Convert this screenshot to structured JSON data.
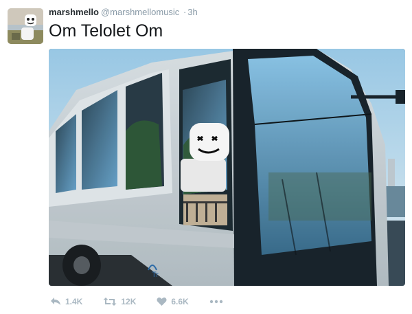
{
  "tweet": {
    "display_name": "marshmello",
    "handle": "@marshmellomusic",
    "separator": "·",
    "time": "3h",
    "text": "Om Telolet Om",
    "avatar_icon": "marshmello-avatar-icon",
    "media_description_icon": "bus-photo"
  },
  "actions": {
    "reply_count": "1.4K",
    "retweet_count": "12K",
    "like_count": "6.6K"
  },
  "colors": {
    "name": "#292f33",
    "meta": "#8899a6",
    "action": "#aab8c2"
  }
}
